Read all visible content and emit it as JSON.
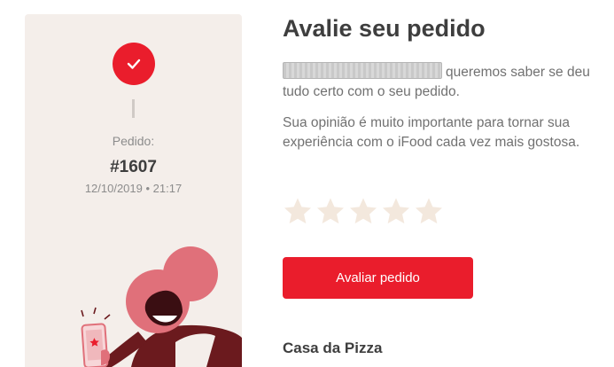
{
  "order": {
    "label": "Pedido:",
    "number": "#1607",
    "datetime": "12/10/2019 • 21:17",
    "status_icon": "check-icon"
  },
  "main": {
    "title": "Avalie seu pedido",
    "intro_text": "queremos saber se deu tudo certo com o seu pedido.",
    "body_text": "Sua opinião é muito importante para tornar sua experiência com o iFood cada vez mais gostosa.",
    "rating": {
      "max": 5,
      "value": 0,
      "star_icon": "star-icon"
    },
    "button_label": "Avaliar pedido",
    "store_name": "Casa da Pizza"
  },
  "colors": {
    "brand_red": "#ea1d2c",
    "card_bg": "#f4eeea",
    "star_empty": "#f3e8dd",
    "text_dark": "#3e3e3e",
    "text_muted": "#717171"
  }
}
